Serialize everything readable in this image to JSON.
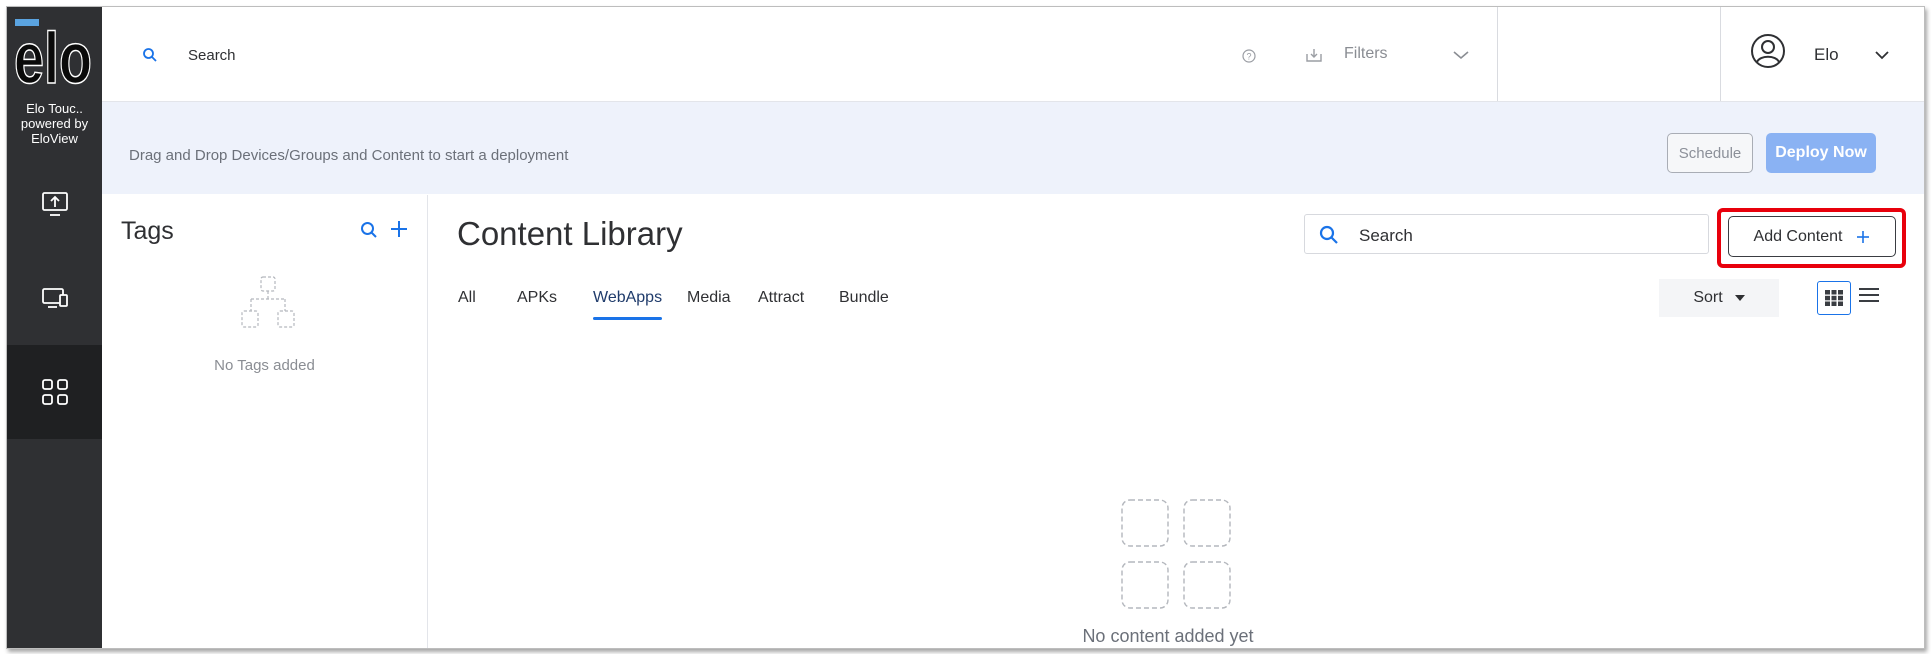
{
  "sidebar": {
    "logo_text": "elo",
    "org_name_line1": "Elo Touc..",
    "org_name_line2": "powered by",
    "org_name_line3": "EloView",
    "items": [
      {
        "icon": "upload-display-icon"
      },
      {
        "icon": "devices-icon"
      },
      {
        "icon": "content-grid-icon",
        "active": true
      }
    ]
  },
  "topbar": {
    "search_placeholder": "Search",
    "filters_label": "Filters",
    "user_name": "Elo"
  },
  "banner": {
    "message": "Drag and Drop Devices/Groups and Content to start a deployment",
    "schedule_label": "Schedule",
    "deploy_label": "Deploy Now"
  },
  "tags": {
    "title": "Tags",
    "empty_text": "No Tags added"
  },
  "content": {
    "title": "Content Library",
    "search_placeholder": "Search",
    "add_button_label": "Add Content",
    "tabs": [
      {
        "label": "All"
      },
      {
        "label": "APKs"
      },
      {
        "label": "WebApps",
        "active": true
      },
      {
        "label": "Media"
      },
      {
        "label": "Attract"
      },
      {
        "label": "Bundle"
      }
    ],
    "sort_label": "Sort",
    "empty_text": "No content added yet"
  },
  "colors": {
    "sidebar_bg": "#2f3033",
    "accent_blue": "#1a73e8",
    "deploy_button": "#8ab2f3",
    "highlight_red": "#e8000c",
    "banner_bg": "#eef2fb"
  }
}
